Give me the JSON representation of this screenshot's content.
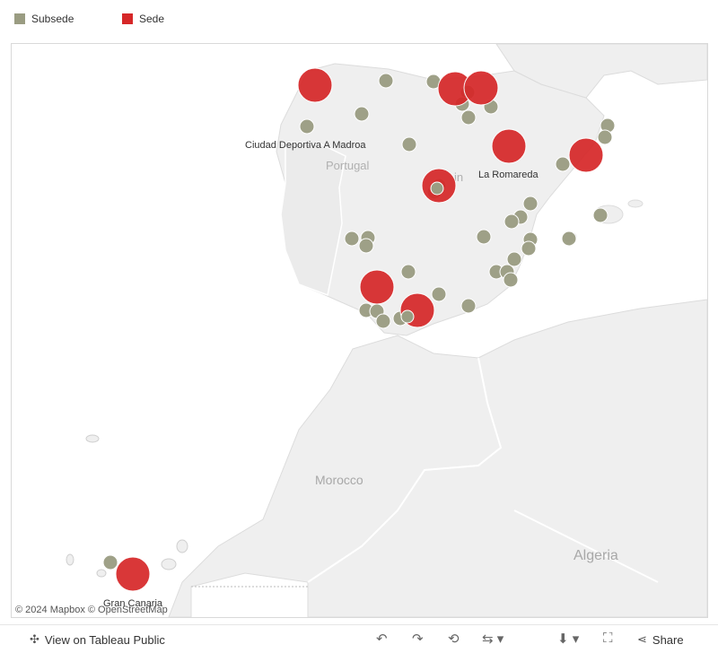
{
  "legend": {
    "items": [
      {
        "label": "Subsede",
        "color": "#9a9c82"
      },
      {
        "label": "Sede",
        "color": "#d62728"
      }
    ]
  },
  "map": {
    "labels": {
      "portugal": "Portugal",
      "spain_fragment": "in",
      "morocco": "Morocco",
      "algeria": "Algeria"
    },
    "venue_labels": {
      "coruna": "Ciudad Deportiva A Madroa",
      "zaragoza": "La Romareda",
      "gran_canaria": "Gran Canaria"
    },
    "attribution": "© 2024 Mapbox  © OpenStreetMap",
    "colors": {
      "land": "#f2f2f2",
      "water": "#ffffff",
      "border": "#ffffff",
      "subsede": "#9a9c82",
      "sede": "#d62728"
    }
  },
  "toolbar": {
    "view_label": "View on Tableau Public",
    "share_label": "Share",
    "icons": [
      "tableau-logo-icon",
      "undo-icon",
      "redo-icon",
      "revert-icon",
      "refresh-icon",
      "download-icon",
      "fullscreen-icon",
      "share-icon"
    ]
  }
}
